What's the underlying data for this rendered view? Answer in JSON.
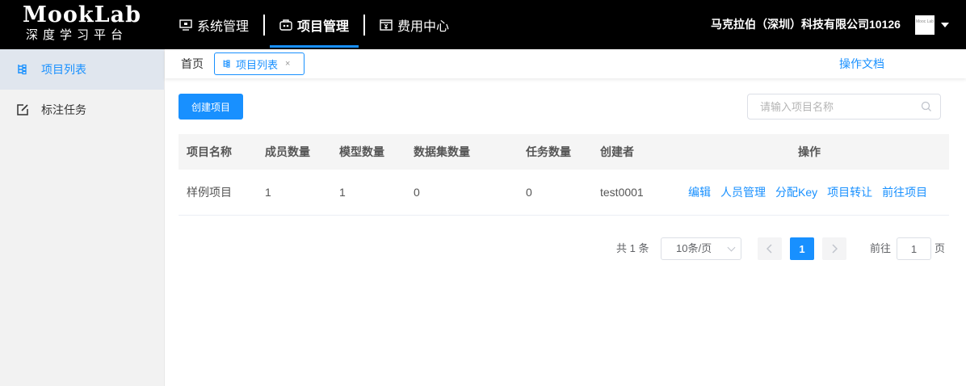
{
  "header": {
    "logo_main": "MookLab",
    "logo_sub": "深度学习平台",
    "nav": [
      {
        "label": "系统管理",
        "icon": "monitor-icon"
      },
      {
        "label": "项目管理",
        "icon": "briefcase-icon",
        "active": true
      },
      {
        "label": "费用中心",
        "icon": "wallet-icon"
      }
    ],
    "company": "马克拉伯（深圳）科技有限公司10126",
    "avatar_text": "Mooc Lab"
  },
  "sidebar": {
    "items": [
      {
        "label": "项目列表",
        "icon": "project-list-icon",
        "active": true
      },
      {
        "label": "标注任务",
        "icon": "edit-icon"
      }
    ]
  },
  "tabs": {
    "home": "首页",
    "active_tab": "项目列表",
    "close": "×",
    "docs": "操作文档"
  },
  "toolbar": {
    "create_label": "创建项目",
    "search_placeholder": "请输入项目名称"
  },
  "table": {
    "columns": [
      "项目名称",
      "成员数量",
      "模型数量",
      "数据集数量",
      "任务数量",
      "创建者",
      "操作"
    ],
    "rows": [
      {
        "name": "样例项目",
        "members": "1",
        "models": "1",
        "datasets": "0",
        "tasks": "0",
        "creator": "test0001"
      }
    ],
    "actions": [
      "编辑",
      "人员管理",
      "分配Key",
      "项目转让",
      "前往项目"
    ]
  },
  "pagination": {
    "total": "共 1 条",
    "page_size": "10条/页",
    "current_page": "1",
    "goto_label": "前往",
    "goto_value": "1",
    "page_label": "页"
  },
  "colors": {
    "accent": "#1890ff",
    "header_bg": "#000000",
    "sidebar_bg": "#f2f2f2"
  }
}
